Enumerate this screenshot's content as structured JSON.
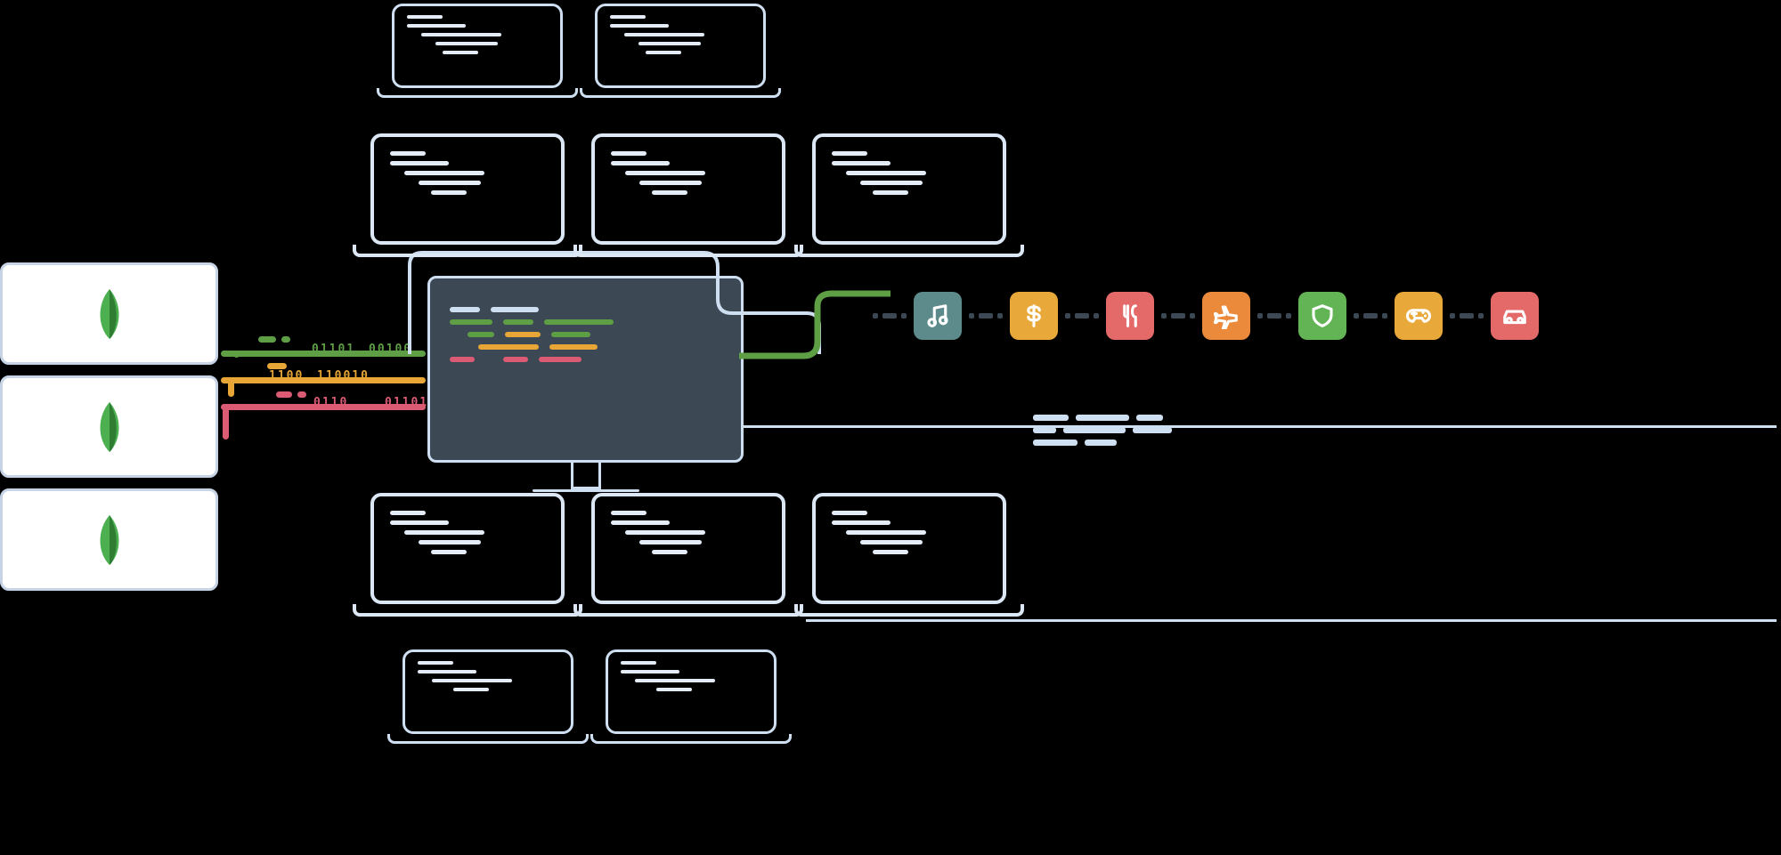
{
  "binary_labels": {
    "g1": "01101",
    "g2": "00100",
    "y1": "1100",
    "y2": "110010",
    "p1": "0110",
    "p2": "01101"
  },
  "colors": {
    "green": "#5e9e45",
    "yellow": "#e7a636",
    "pink": "#db5a74",
    "outline": "#cfdff2",
    "monitor": "#3c4854",
    "leaf": "#4caf50"
  },
  "app_badges": [
    {
      "name": "music",
      "color": "bg-te"
    },
    {
      "name": "currency",
      "color": "bg-ye"
    },
    {
      "name": "food",
      "color": "bg-pk"
    },
    {
      "name": "travel",
      "color": "bg-or"
    },
    {
      "name": "security",
      "color": "bg-gr"
    },
    {
      "name": "gaming",
      "color": "bg-ye"
    },
    {
      "name": "auto",
      "color": "bg-pk"
    }
  ],
  "db_nodes": 3,
  "laptops": {
    "rows": [
      2,
      3,
      3,
      2
    ]
  }
}
